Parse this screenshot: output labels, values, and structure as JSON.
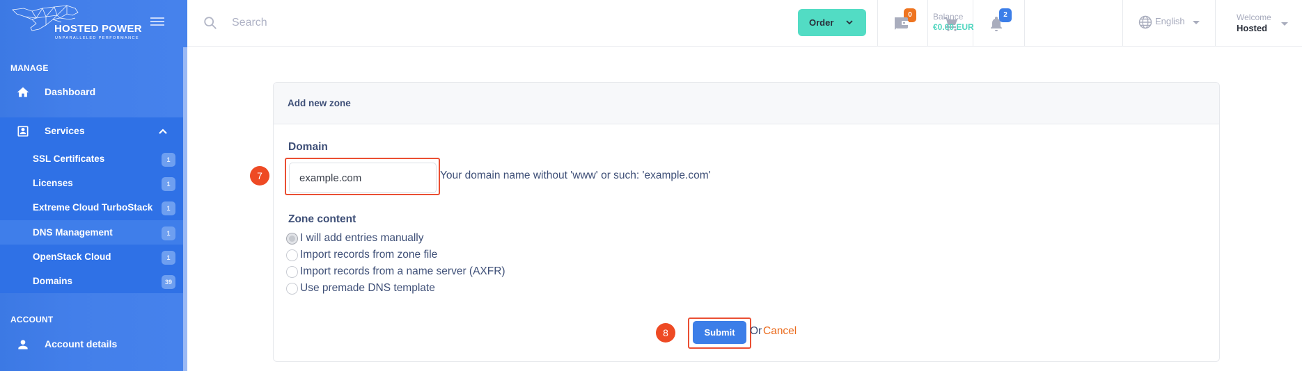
{
  "brand": {
    "name": "HOSTED POWER",
    "tagline": "UNPARALLELED PERFORMANCE"
  },
  "sidebar": {
    "manage_title": "MANAGE",
    "dashboard": {
      "label": "Dashboard",
      "icon": "home-icon"
    },
    "services": {
      "label": "Services",
      "icon": "account-box-icon",
      "expanded": true,
      "items": [
        {
          "label": "SSL Certificates",
          "count": "1"
        },
        {
          "label": "Licenses",
          "count": "1"
        },
        {
          "label": "Extreme Cloud TurboStack",
          "count": "1"
        },
        {
          "label": "DNS Management",
          "count": "1",
          "active": true
        },
        {
          "label": "OpenStack Cloud",
          "count": "1"
        },
        {
          "label": "Domains",
          "count": "39"
        }
      ]
    },
    "account_title": "ACCOUNT",
    "account_details": {
      "label": "Account details",
      "icon": "person-icon"
    }
  },
  "header": {
    "search_placeholder": "Search",
    "order_label": "Order",
    "tickets_count": "0",
    "notifications_count": "2",
    "balance_label": "Balance",
    "balance_value": "€0.00 EUR",
    "language": "English",
    "welcome_label": "Welcome",
    "user_name": "Hosted"
  },
  "form": {
    "card_title": "Add new zone",
    "domain_label": "Domain",
    "domain_value": "example.com",
    "domain_help": "Your domain name without 'www' or such: 'example.com'",
    "zone_content_label": "Zone content",
    "zone_options": [
      {
        "label": "I will add entries manually",
        "checked": true
      },
      {
        "label": "Import records from zone file",
        "checked": false
      },
      {
        "label": "Import records from a name server (AXFR)",
        "checked": false
      },
      {
        "label": "Use premade DNS template",
        "checked": false
      }
    ],
    "submit_label": "Submit",
    "or_text": "Or",
    "cancel_label": "Cancel"
  },
  "annotations": {
    "step_domain": "7",
    "step_submit": "8"
  },
  "colors": {
    "sidebar_blue": "#4682ec",
    "accent_teal": "#52dcc4",
    "primary_blue": "#3c7ee8",
    "cancel_orange": "#ea6a1c",
    "highlight_red": "#ea4f33"
  }
}
